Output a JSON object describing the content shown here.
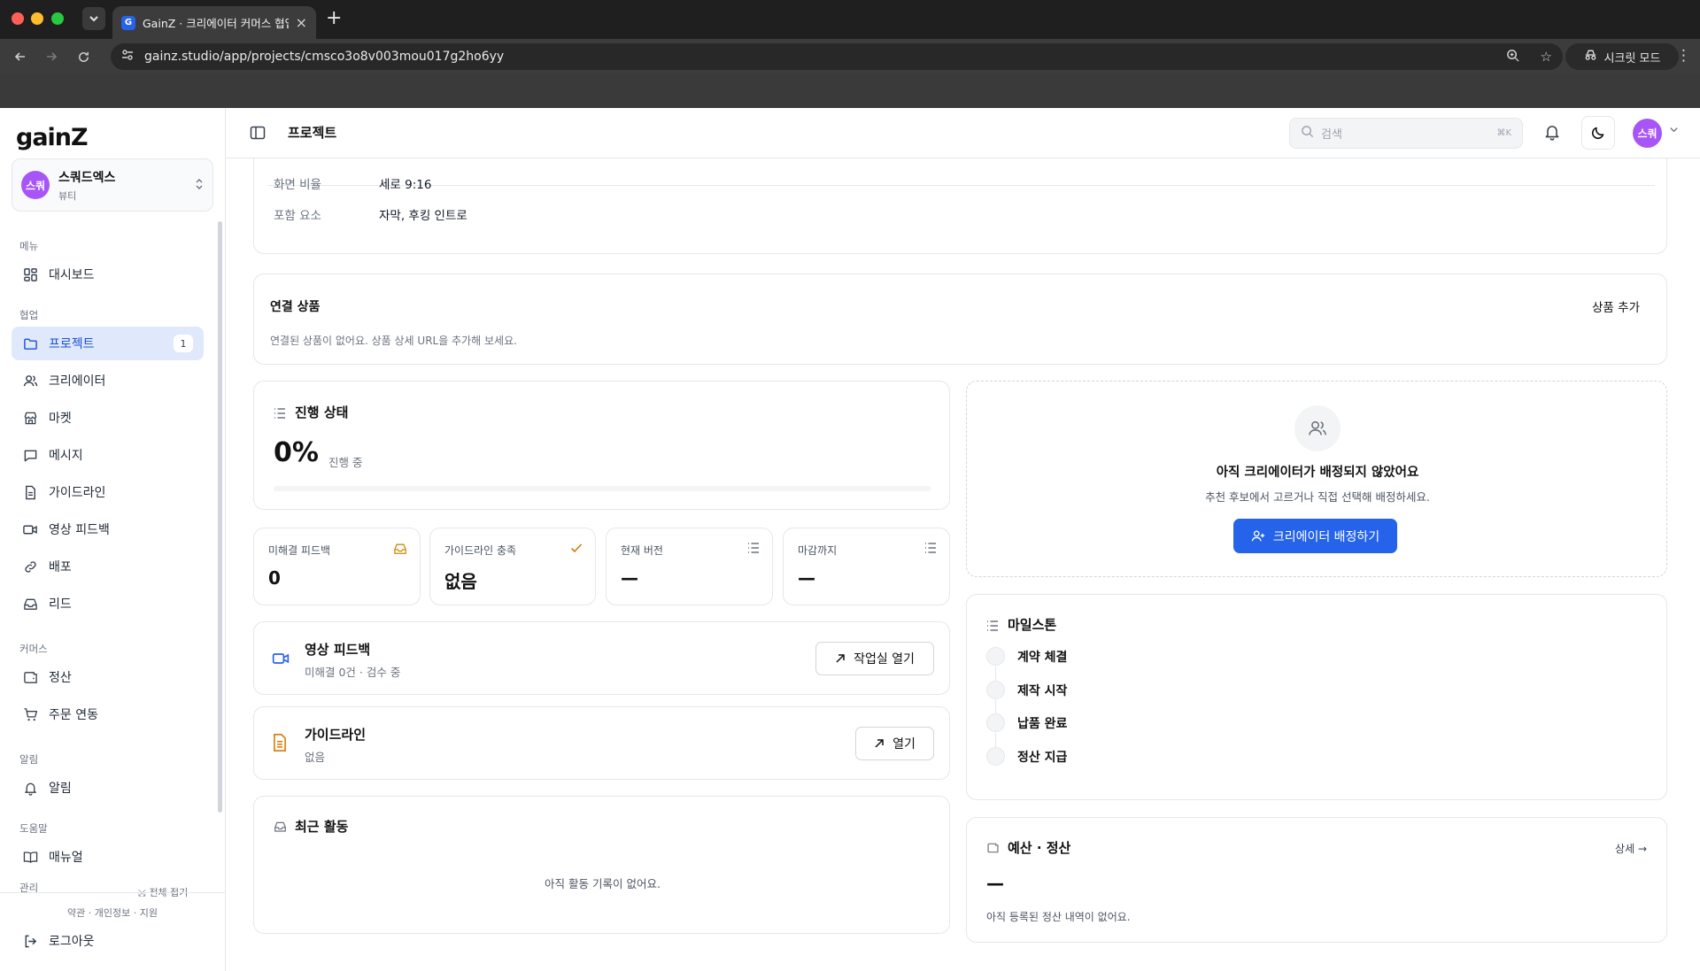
{
  "browser": {
    "tab_title": "GainZ · 크리에이터 커머스 협업 C",
    "url": "gainz.studio/app/projects/cmsco3o8v003mou017g2ho6yy",
    "incognito_label": "시크릿 모드",
    "colors": {
      "close": "#ff5f57",
      "minimize": "#febc2e",
      "maximize": "#28c840"
    }
  },
  "sidebar": {
    "logo": "gainZ",
    "workspace": {
      "avatar": "스쿼",
      "name": "스쿼드엑스",
      "sub": "뷰티"
    },
    "sections": {
      "menu": "메뉴",
      "collab": "협업",
      "commerce": "커머스",
      "alerts": "알림",
      "help": "도움말",
      "admin": "관리"
    },
    "items": {
      "dashboard": "대시보드",
      "projects": "프로젝트",
      "projects_badge": "1",
      "creators": "크리에이터",
      "market": "마켓",
      "messages": "메시지",
      "guidelines": "가이드라인",
      "video_feedback": "영상 피드백",
      "distribution": "배포",
      "leads": "리드",
      "settlement": "정산",
      "order_sync": "주문 연동",
      "notifications": "알림",
      "manual": "매뉴얼"
    },
    "collapse_all": "전체 접기",
    "footer_links": "약관 · 개인정보 · 지원",
    "logout": "로그아웃"
  },
  "topbar": {
    "title": "프로젝트",
    "search_placeholder": "검색",
    "search_shortcut": "⌘K",
    "user_avatar": "스쿼"
  },
  "details": {
    "aspect_ratio_label": "화면 비율",
    "aspect_ratio_value": "세로 9:16",
    "included_label": "포함 요소",
    "included_value": "자막, 후킹 인트로"
  },
  "linked_products": {
    "title": "연결 상품",
    "add_button": "상품 추가",
    "empty": "연결된 상품이 없어요. 상품 상세 URL을 추가해 보세요."
  },
  "progress": {
    "title": "진행 상태",
    "percent_text": "0%",
    "percent_value": 0,
    "status": "진행 중"
  },
  "stats": {
    "unresolved_label": "미해결 피드백",
    "unresolved_value": "0",
    "guideline_label": "가이드라인 충족",
    "guideline_value": "없음",
    "version_label": "현재 버전",
    "version_value": "—",
    "deadline_label": "마감까지",
    "deadline_value": "—"
  },
  "video_feedback": {
    "title": "영상 피드백",
    "sub": "미해결 0건 · 검수 중",
    "button": "작업실 열기"
  },
  "guideline": {
    "title": "가이드라인",
    "sub": "없음",
    "button": "열기"
  },
  "activity": {
    "title": "최근 활동",
    "empty": "아직 활동 기록이 없어요."
  },
  "creator_assign": {
    "title": "아직 크리에이터가 배정되지 않았어요",
    "sub": "추천 후보에서 고르거나 직접 선택해 배정하세요.",
    "button": "크리에이터 배정하기"
  },
  "milestones": {
    "title": "마일스톤",
    "items": [
      "계약 체결",
      "제작 시작",
      "납품 완료",
      "정산 지급"
    ]
  },
  "budget": {
    "title": "예산 · 정산",
    "detail_link": "상세 →",
    "value": "—",
    "empty": "아직 등록된 정산 내역이 없어요."
  },
  "colors": {
    "accent": "#2563eb",
    "avatar": "#a855f7",
    "active_nav_bg": "#e0e9fb",
    "warning_icon": "#ca8a04",
    "orange_icon": "#d97706"
  }
}
